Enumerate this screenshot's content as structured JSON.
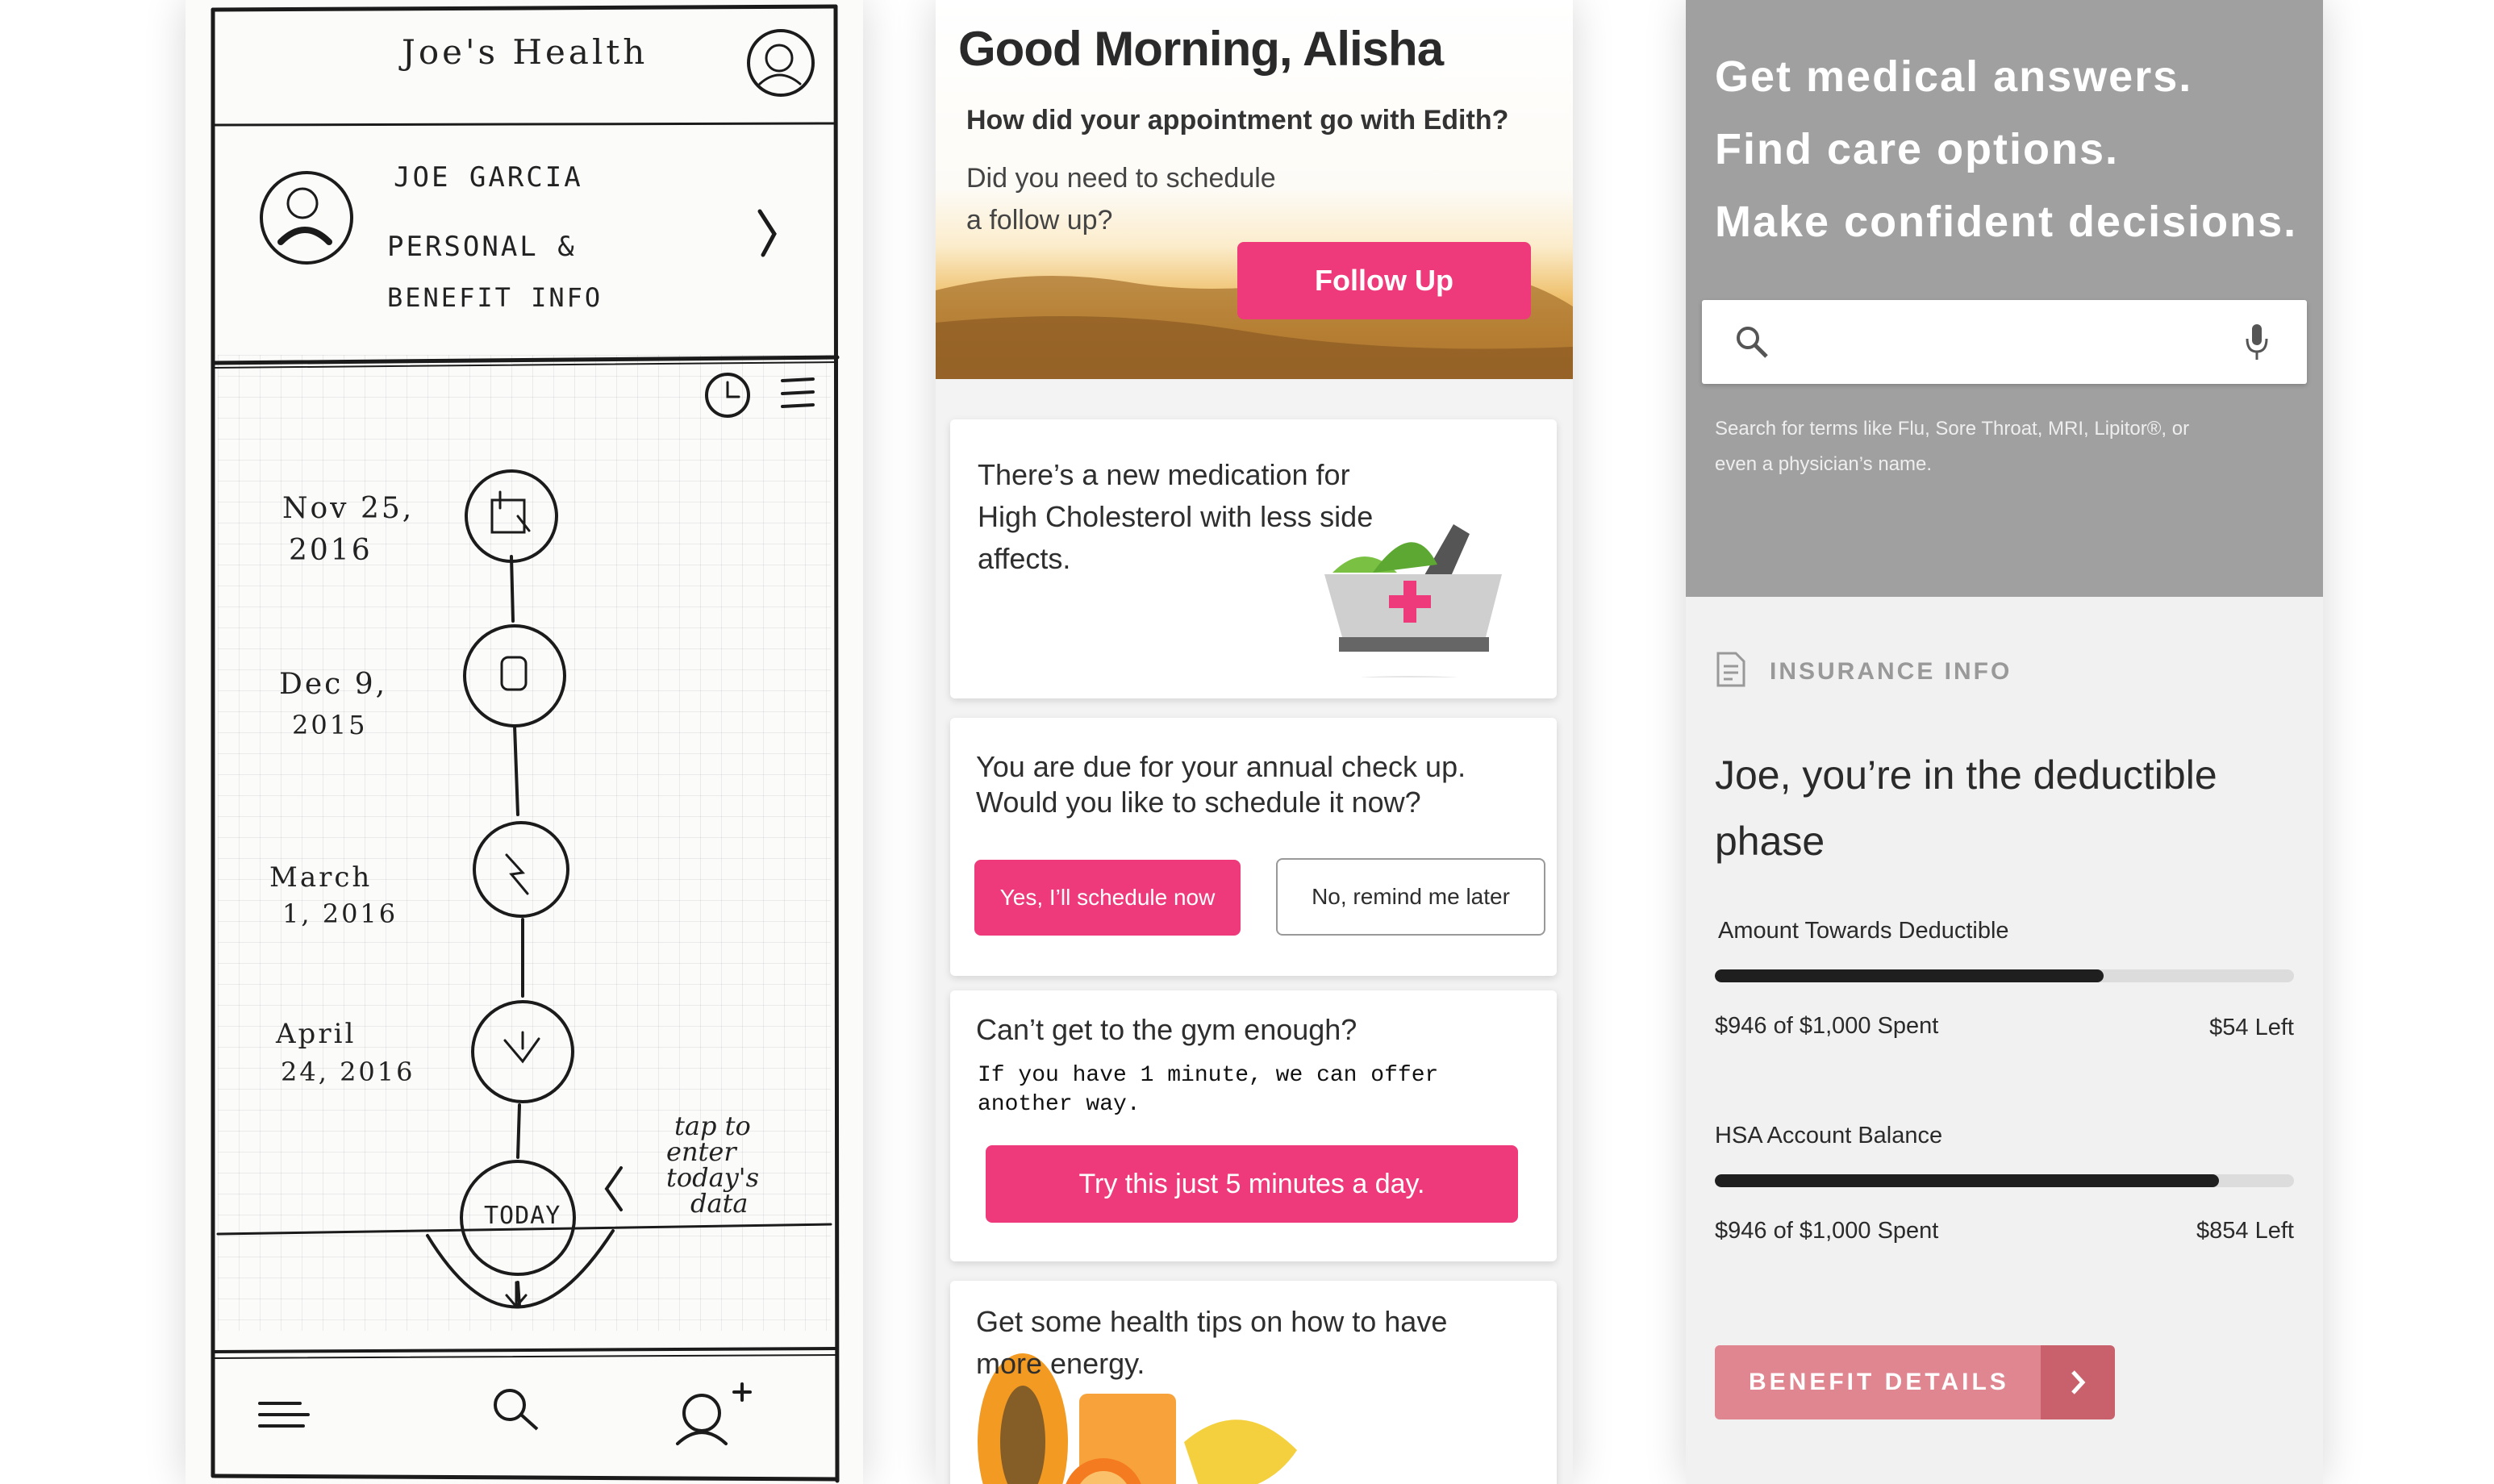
{
  "sketch": {
    "app_title": "Joe's Health",
    "profile": {
      "name": "Joe Garcia",
      "line1": "Personal &",
      "line2": "Benefit Info"
    },
    "timeline": [
      {
        "date_line1": "Nov 25,",
        "date_line2": "2016"
      },
      {
        "date_line1": "Dec 9,",
        "date_line2": "2015"
      },
      {
        "date_line1": "March",
        "date_line2": "1, 2016"
      },
      {
        "date_line1": "April",
        "date_line2": "24, 2016"
      }
    ],
    "today_label": "Today",
    "hint_line1": "tap to",
    "hint_line2": "enter",
    "hint_line3": "today's",
    "hint_line4": "data"
  },
  "feed": {
    "greeting": "Good Morning, Alisha",
    "question": "How did your appointment go with Edith?",
    "followup_line1": "Did you need to schedule",
    "followup_line2": "a follow up?",
    "followup_button": "Follow Up",
    "med_line1": "There’s a new medication for",
    "med_line2": "High Cholesterol with less side",
    "med_line3": "affects.",
    "checkup_line1": "You are due for your annual check up.",
    "checkup_line2": "Would you like to schedule it now?",
    "yes_button": "Yes, I’ll schedule now",
    "no_button": "No, remind me later",
    "gym_title": "Can’t get to the gym enough?",
    "gym_line1": "If you have 1 minute, we can offer",
    "gym_line2": "another way.",
    "gym_button": "Try this just 5 minutes a day.",
    "tips_line1": "Get some health tips on how to have",
    "tips_line2": "more energy."
  },
  "insurance": {
    "headline1": "Get medical answers.",
    "headline2": "Find care options.",
    "headline3": "Make confident decisions.",
    "search_hint_line1": "Search for terms like Flu, Sore Throat, MRI, Lipitor®, or",
    "search_hint_line2": "even a physician’s name.",
    "section_label": "INSURANCE INFO",
    "phase_line1": "Joe, you’re in the deductible",
    "phase_line2": "phase",
    "deductible_label": "Amount Towards Deductible",
    "deductible_progress": 0.672,
    "deductible_spent": "$946 of $1,000 Spent",
    "deductible_left": "$54 Left",
    "hsa_label": "HSA Account Balance",
    "hsa_progress": 0.87,
    "hsa_spent": "$946 of $1,000 Spent",
    "hsa_left": "$854 Left",
    "details_button": "BENEFIT DETAILS"
  },
  "colors": {
    "accent": "#ee3a7b",
    "button_muted": "#e08690",
    "header_gray": "#a0a0a0"
  }
}
